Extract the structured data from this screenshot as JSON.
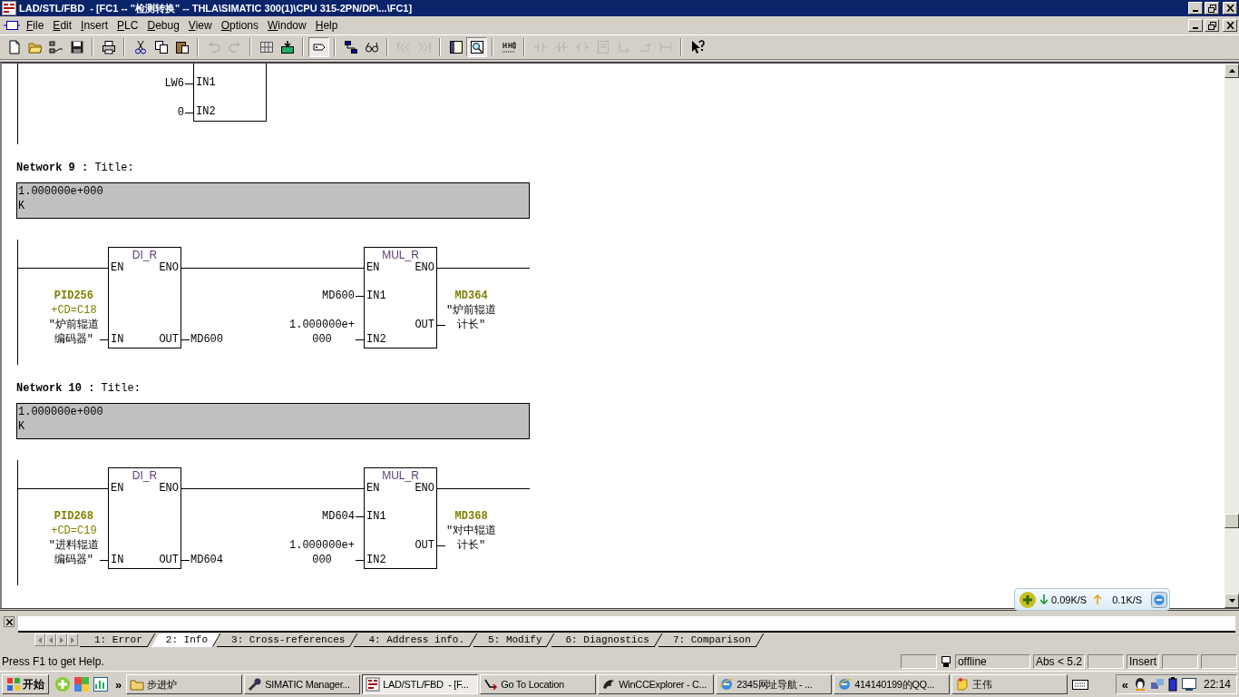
{
  "window": {
    "title": "LAD/STL/FBD  - [FC1 -- \"检测转换\" -- THLA\\SIMATIC 300(1)\\CPU 315-2PN/DP\\...\\FC1]"
  },
  "menu": [
    "File",
    "Edit",
    "Insert",
    "PLC",
    "Debug",
    "View",
    "Options",
    "Window",
    "Help"
  ],
  "toolbar": [
    {
      "buttons": [
        {
          "pressed": false,
          "disabled": false
        },
        {
          "pressed": false,
          "disabled": false
        },
        {
          "pressed": false,
          "disabled": false
        },
        {
          "pressed": false,
          "disabled": false
        }
      ]
    },
    {
      "buttons": [
        {
          "pressed": false,
          "disabled": false
        }
      ]
    },
    {
      "buttons": [
        {
          "pressed": false,
          "disabled": false
        },
        {
          "pressed": false,
          "disabled": false
        },
        {
          "pressed": false,
          "disabled": false
        }
      ]
    },
    {
      "buttons": [
        {
          "pressed": false,
          "disabled": true
        },
        {
          "pressed": false,
          "disabled": true
        }
      ]
    },
    {
      "buttons": [
        {
          "pressed": false,
          "disabled": false
        },
        {
          "pressed": false,
          "disabled": false
        }
      ]
    },
    {
      "buttons": [
        {
          "pressed": true,
          "disabled": false
        }
      ]
    },
    {
      "buttons": [
        {
          "pressed": false,
          "disabled": false
        },
        {
          "pressed": false,
          "disabled": false
        }
      ]
    },
    {
      "buttons": [
        {
          "pressed": false,
          "disabled": true
        },
        {
          "pressed": false,
          "disabled": true
        }
      ]
    },
    {
      "buttons": [
        {
          "pressed": false,
          "disabled": false
        },
        {
          "pressed": true,
          "disabled": false
        }
      ]
    },
    {
      "buttons": [
        {
          "pressed": false,
          "disabled": false
        }
      ]
    },
    {
      "buttons": [
        {
          "pressed": false,
          "disabled": true
        },
        {
          "pressed": false,
          "disabled": true
        },
        {
          "pressed": false,
          "disabled": true
        },
        {
          "pressed": false,
          "disabled": true
        },
        {
          "pressed": false,
          "disabled": true
        },
        {
          "pressed": false,
          "disabled": true
        },
        {
          "pressed": false,
          "disabled": true
        }
      ]
    },
    {
      "buttons": [
        {
          "pressed": false,
          "disabled": false
        }
      ]
    }
  ],
  "networks": [
    {
      "kind": "partial",
      "blocks": [
        {
          "kind": "tail",
          "left": [
            {
              "pin": "IN1",
              "operand": [
                {
                  "text": "LW6",
                  "kind": "plain"
                }
              ]
            },
            {
              "pin": "IN2",
              "operand": [
                {
                  "text": "0",
                  "kind": "plain"
                }
              ]
            }
          ]
        }
      ]
    },
    {
      "kind": "full",
      "heading": "**Network 9 :** Title:",
      "comment": [
        "1.000000e+000",
        "K"
      ],
      "blocks": [
        {
          "kind": "convert",
          "title": "DI_R",
          "left": [
            {
              "pin": "EN"
            },
            {
              "pin": "IN",
              "operand": [
                {
                  "text": "PID256",
                  "kind": "address"
                },
                {
                  "text": "+CD=C18",
                  "kind": "info"
                },
                {
                  "text": "\"炉前辊道",
                  "kind": "plain"
                },
                {
                  "text": "编码器\"",
                  "kind": "plain"
                }
              ]
            }
          ],
          "right": [
            {
              "pin": "ENO"
            },
            {
              "pin": "OUT",
              "operand": [
                {
                  "text": "MD600",
                  "kind": "plain"
                }
              ]
            }
          ]
        },
        {
          "kind": "math",
          "title": "MUL_R",
          "left": [
            {
              "pin": "EN"
            },
            {
              "pin": "IN1",
              "operand": [
                {
                  "text": "MD600",
                  "kind": "plain"
                }
              ]
            },
            {
              "pin": "IN2",
              "operand": [
                {
                  "text": "1.000000e+",
                  "kind": "plain"
                },
                {
                  "text": "000",
                  "kind": "plain"
                }
              ]
            }
          ],
          "right": [
            {
              "pin": "ENO"
            },
            {
              "pin": "OUT",
              "operand": [
                {
                  "text": "MD364",
                  "kind": "address"
                },
                {
                  "text": "\"炉前辊道",
                  "kind": "plain"
                },
                {
                  "text": "计长\"",
                  "kind": "plain"
                }
              ]
            }
          ]
        }
      ]
    },
    {
      "kind": "full",
      "heading": "**Network 10 :** Title:",
      "comment": [
        "1.000000e+000",
        "K"
      ],
      "blocks": [
        {
          "kind": "convert",
          "title": "DI_R",
          "left": [
            {
              "pin": "EN"
            },
            {
              "pin": "IN",
              "operand": [
                {
                  "text": "PID268",
                  "kind": "address"
                },
                {
                  "text": "+CD=C19",
                  "kind": "info"
                },
                {
                  "text": "\"进料辊道",
                  "kind": "plain"
                },
                {
                  "text": "编码器\"",
                  "kind": "plain"
                }
              ]
            }
          ],
          "right": [
            {
              "pin": "ENO"
            },
            {
              "pin": "OUT",
              "operand": [
                {
                  "text": "MD604",
                  "kind": "plain"
                }
              ]
            }
          ]
        },
        {
          "kind": "math",
          "title": "MUL_R",
          "left": [
            {
              "pin": "EN"
            },
            {
              "pin": "IN1",
              "operand": [
                {
                  "text": "MD604",
                  "kind": "plain"
                }
              ]
            },
            {
              "pin": "IN2",
              "operand": [
                {
                  "text": "1.000000e+",
                  "kind": "plain"
                },
                {
                  "text": "000",
                  "kind": "plain"
                }
              ]
            }
          ],
          "right": [
            {
              "pin": "ENO"
            },
            {
              "pin": "OUT",
              "operand": [
                {
                  "text": "MD368",
                  "kind": "address"
                },
                {
                  "text": "\"对中辊道",
                  "kind": "plain"
                },
                {
                  "text": "计长\"",
                  "kind": "plain"
                }
              ]
            }
          ]
        }
      ]
    }
  ],
  "net_speed": {
    "down": "0.09K/S",
    "up": "0.1K/S"
  },
  "detail_tabs": [
    {
      "label": "1: Error",
      "selected": false
    },
    {
      "label": "2: Info",
      "selected": true
    },
    {
      "label": "3: Cross-references",
      "selected": false
    },
    {
      "label": "4: Address info.",
      "selected": false
    },
    {
      "label": "5: Modify",
      "selected": false
    },
    {
      "label": "6: Diagnostics",
      "selected": false
    },
    {
      "label": "7: Comparison",
      "selected": false
    }
  ],
  "status_bar": {
    "help": "Press F1 to get Help.",
    "panes": [
      {
        "kind": "blank"
      },
      {
        "kind": "connection",
        "text": "offline"
      },
      {
        "kind": "text",
        "text": "Abs < 5.2"
      },
      {
        "kind": "blank"
      },
      {
        "kind": "text",
        "text": "Insert"
      },
      {
        "kind": "blank"
      },
      {
        "kind": "blank"
      }
    ]
  },
  "taskbar": {
    "start": "开始",
    "more": "»",
    "tasks": [
      {
        "label": "步进炉",
        "selected": false
      },
      {
        "label": "SIMATIC Manager...",
        "selected": false
      },
      {
        "label": "LAD/STL/FBD  - [F...",
        "selected": true
      },
      {
        "label": "Go To Location",
        "selected": false
      },
      {
        "label": "WinCCExplorer - C...",
        "selected": false
      },
      {
        "label": "2345网址导航 - ...",
        "selected": false
      },
      {
        "label": "414140199的QQ...",
        "selected": false
      },
      {
        "label": "王伟",
        "selected": false
      }
    ],
    "tray_expand": "«",
    "clock": "22:14"
  }
}
